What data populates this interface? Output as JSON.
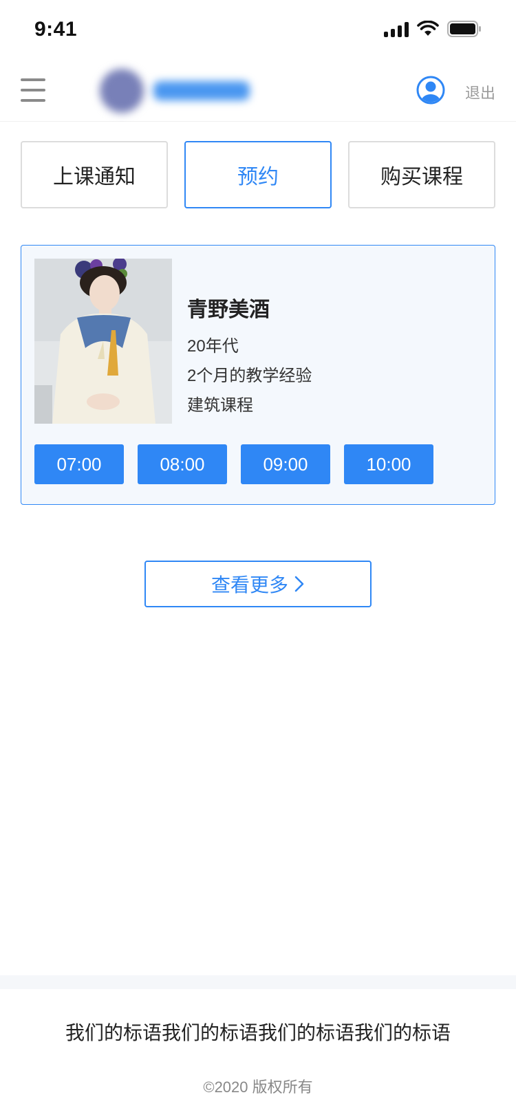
{
  "status_bar": {
    "time": "9:41"
  },
  "header": {
    "menu_icon": "hamburger-menu-icon",
    "avatar_icon": "user-avatar-icon",
    "logout_label": "退出"
  },
  "tabs": [
    {
      "label": "上课通知",
      "active": false
    },
    {
      "label": "预约",
      "active": true
    },
    {
      "label": "购买课程",
      "active": false
    }
  ],
  "teacher_card": {
    "name": "青野美酒",
    "age": "20年代",
    "experience": "2个月的教学经验",
    "course": "建筑课程",
    "time_slots": [
      "07:00",
      "08:00",
      "09:00",
      "10:00"
    ]
  },
  "more_button": {
    "label": "查看更多"
  },
  "footer": {
    "slogan": "我们的标语我们的标语我们的标语我们的标语",
    "copyright": "©2020 版权所有"
  },
  "colors": {
    "accent": "#2f87f5",
    "card_bg": "#f4f8fd",
    "border": "#dcdcdc"
  }
}
